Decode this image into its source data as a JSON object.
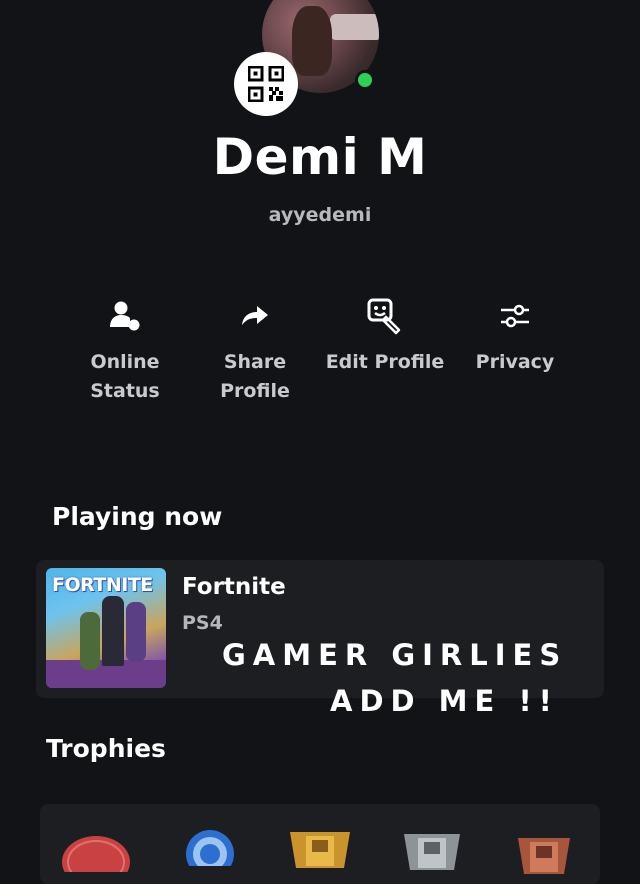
{
  "profile": {
    "display_name": "Demi M",
    "online_id": "ayyedemi"
  },
  "actions": [
    {
      "line1": "Online",
      "line2": "Status",
      "icon": "online-status-icon"
    },
    {
      "line1": "Share",
      "line2": "Profile",
      "icon": "share-arrow-icon"
    },
    {
      "line1": "Edit Profile",
      "line2": "",
      "icon": "edit-profile-icon"
    },
    {
      "line1": "Privacy",
      "line2": "",
      "icon": "sliders-icon"
    }
  ],
  "playing_now": {
    "title": "Playing now",
    "game": {
      "name": "Fortnite",
      "platform": "PS4",
      "cover_logo": "FORTNITE"
    }
  },
  "overlay_text": {
    "line1": "GAMER GIRLIES",
    "line2": "ADD ME !!"
  },
  "trophies": {
    "title": "Trophies",
    "icons": [
      "level-badge-icon",
      "platinum-trophy-icon",
      "gold-trophy-icon",
      "silver-trophy-icon",
      "bronze-trophy-icon"
    ]
  },
  "colors": {
    "background": "#121316",
    "card": "#1d1e22",
    "online": "#2ed158"
  }
}
